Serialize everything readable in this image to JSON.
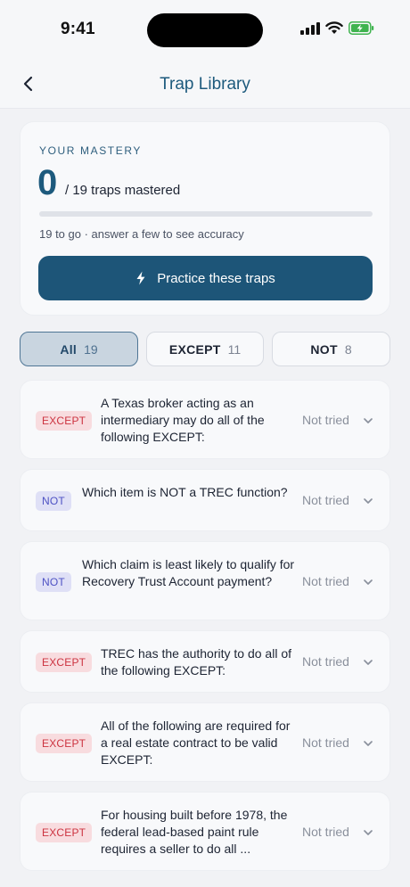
{
  "status_bar": {
    "time": "9:41"
  },
  "nav": {
    "title": "Trap Library"
  },
  "mastery": {
    "label": "YOUR MASTERY",
    "mastered": "0",
    "of_text": "/ 19 traps mastered",
    "progress_fraction": 0,
    "sub_text": "19 to go · answer a few to see accuracy",
    "practice_label": "Practice these traps"
  },
  "filters": [
    {
      "label": "All",
      "count": "19",
      "active": true
    },
    {
      "label": "EXCEPT",
      "count": "11",
      "active": false
    },
    {
      "label": "NOT",
      "count": "8",
      "active": false
    }
  ],
  "traps": [
    {
      "type": "EXCEPT",
      "text": "A Texas broker acting as an intermediary may do all of the following EXCEPT:",
      "status": "Not tried"
    },
    {
      "type": "NOT",
      "text": "Which item is NOT a TREC function?",
      "status": "Not tried"
    },
    {
      "type": "NOT",
      "text": "Which claim is least likely to qualify for Recovery Trust Account payment?",
      "status": "Not tried"
    },
    {
      "type": "EXCEPT",
      "text": "TREC has the authority to do all of the following EXCEPT:",
      "status": "Not tried"
    },
    {
      "type": "EXCEPT",
      "text": "All of the following are required for a real estate contract to be valid EXCEPT:",
      "status": "Not tried"
    },
    {
      "type": "EXCEPT",
      "text": "For housing built before 1978, the federal lead-based paint rule requires a seller to do all ...",
      "status": "Not tried"
    }
  ],
  "colors": {
    "accent": "#1d5a7d",
    "except_badge": "#cc3340",
    "not_badge": "#4e52c4"
  },
  "icons": {
    "back": "chevron-left-icon",
    "practice": "lightning-bolt-icon",
    "expand": "chevron-down-icon"
  }
}
